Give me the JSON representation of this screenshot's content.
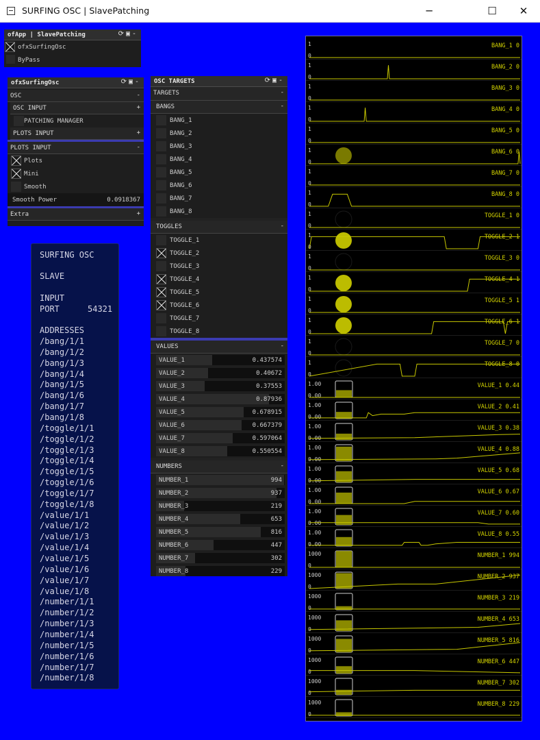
{
  "window": {
    "title": "SURFING OSC | SlavePatching",
    "minimize": "─",
    "maximize": "☐",
    "close": "✕"
  },
  "app_panel": {
    "title": "ofApp | SlavePatching",
    "items": [
      {
        "label": "ofxSurfingOsc",
        "checked": true
      },
      {
        "label": "ByPass",
        "checked": false
      }
    ]
  },
  "surfing_panel": {
    "title": "ofxSurfingOsc",
    "osc_label": "OSC",
    "osc_toggle": "-",
    "osc_input_label": "OSC INPUT",
    "osc_input_toggle": "+",
    "patching_manager": "PATCHING MANAGER",
    "plots_input_label": "PLOTS INPUT",
    "plots_input_toggle": "+",
    "plots_input2_label": "PLOTS INPUT",
    "plots_input2_toggle": "-",
    "plots": "Plots",
    "mini": "Mini",
    "smooth": "Smooth",
    "smooth_power_label": "Smooth Power",
    "smooth_power_value": "0.0918367",
    "extra_label": "Extra",
    "extra_toggle": "+"
  },
  "osc_targets": {
    "title": "OSC TARGETS",
    "targets_label": "TARGETS",
    "targets_toggle": "-",
    "bangs_label": "BANGS",
    "bangs_toggle": "-",
    "bangs": [
      "BANG_1",
      "BANG_2",
      "BANG_3",
      "BANG_4",
      "BANG_5",
      "BANG_6",
      "BANG_7",
      "BANG_8"
    ],
    "toggles_label": "TOGGLES",
    "toggles_toggle": "-",
    "toggles": [
      {
        "label": "TOGGLE_1",
        "on": false
      },
      {
        "label": "TOGGLE_2",
        "on": true
      },
      {
        "label": "TOGGLE_3",
        "on": false
      },
      {
        "label": "TOGGLE_4",
        "on": true
      },
      {
        "label": "TOGGLE_5",
        "on": true
      },
      {
        "label": "TOGGLE_6",
        "on": true
      },
      {
        "label": "TOGGLE_7",
        "on": false
      },
      {
        "label": "TOGGLE_8",
        "on": false
      }
    ],
    "values_label": "VALUES",
    "values_toggle": "-",
    "values": [
      {
        "label": "VALUE_1",
        "value": "0.437574",
        "fraction": 0.437574
      },
      {
        "label": "VALUE_2",
        "value": "0.40672",
        "fraction": 0.40672
      },
      {
        "label": "VALUE_3",
        "value": "0.37553",
        "fraction": 0.37553
      },
      {
        "label": "VALUE_4",
        "value": "0.87936",
        "fraction": 0.87936
      },
      {
        "label": "VALUE_5",
        "value": "0.678915",
        "fraction": 0.678915
      },
      {
        "label": "VALUE_6",
        "value": "0.667379",
        "fraction": 0.667379
      },
      {
        "label": "VALUE_7",
        "value": "0.597064",
        "fraction": 0.597064
      },
      {
        "label": "VALUE_8",
        "value": "0.550554",
        "fraction": 0.550554
      }
    ],
    "numbers_label": "NUMBERS",
    "numbers_toggle": "-",
    "numbers": [
      {
        "label": "NUMBER_1",
        "value": "994",
        "fraction": 0.994
      },
      {
        "label": "NUMBER_2",
        "value": "937",
        "fraction": 0.937
      },
      {
        "label": "NUMBER_3",
        "value": "219",
        "fraction": 0.219
      },
      {
        "label": "NUMBER_4",
        "value": "653",
        "fraction": 0.653
      },
      {
        "label": "NUMBER_5",
        "value": "816",
        "fraction": 0.816
      },
      {
        "label": "NUMBER_6",
        "value": "447",
        "fraction": 0.447
      },
      {
        "label": "NUMBER_7",
        "value": "302",
        "fraction": 0.302
      },
      {
        "label": "NUMBER_8",
        "value": "229",
        "fraction": 0.229
      }
    ]
  },
  "info": {
    "title": "SURFING OSC",
    "mode": "SLAVE",
    "input": "INPUT",
    "port_label": "PORT",
    "port_value": "54321",
    "addresses_label": "ADDRESSES",
    "addresses": [
      "/bang/1/1",
      "/bang/1/2",
      "/bang/1/3",
      "/bang/1/4",
      "/bang/1/5",
      "/bang/1/6",
      "/bang/1/7",
      "/bang/1/8",
      "/toggle/1/1",
      "/toggle/1/2",
      "/toggle/1/3",
      "/toggle/1/4",
      "/toggle/1/5",
      "/toggle/1/6",
      "/toggle/1/7",
      "/toggle/1/8",
      "/value/1/1",
      "/value/1/2",
      "/value/1/3",
      "/value/1/4",
      "/value/1/5",
      "/value/1/6",
      "/value/1/7",
      "/value/1/8",
      "/number/1/1",
      "/number/1/2",
      "/number/1/3",
      "/number/1/4",
      "/number/1/5",
      "/number/1/6",
      "/number/1/7",
      "/number/1/8"
    ]
  },
  "colors": {
    "background": "#0000ff",
    "plot_line": "#c8c800",
    "plot_text": "#d4d400",
    "plot_bg": "#000000",
    "panel": "#1e1e1e"
  },
  "plots": [
    {
      "label": "BANG_1 0",
      "top": "1",
      "bottom": "0",
      "kind": "bang",
      "level": 0,
      "trace": [
        [
          0,
          0
        ],
        [
          1,
          0
        ]
      ]
    },
    {
      "label": "BANG_2 0",
      "top": "1",
      "bottom": "0",
      "kind": "bang",
      "level": 0,
      "trace": [
        [
          0,
          0
        ],
        [
          0.37,
          0
        ],
        [
          0.375,
          0.9
        ],
        [
          0.38,
          0
        ],
        [
          1,
          0
        ]
      ]
    },
    {
      "label": "BANG_3 0",
      "top": "1",
      "bottom": "0",
      "kind": "bang",
      "level": 0,
      "trace": [
        [
          0,
          0
        ],
        [
          1,
          0
        ]
      ]
    },
    {
      "label": "BANG_4 0",
      "top": "1",
      "bottom": "0",
      "kind": "bang",
      "level": 0,
      "trace": [
        [
          0,
          0
        ],
        [
          0.26,
          0
        ],
        [
          0.265,
          0.9
        ],
        [
          0.27,
          0
        ],
        [
          1,
          0
        ]
      ]
    },
    {
      "label": "BANG_5 0",
      "top": "1",
      "bottom": "0",
      "kind": "bang",
      "level": 0,
      "trace": [
        [
          0,
          0
        ],
        [
          1,
          0
        ]
      ]
    },
    {
      "label": "BANG_6 0",
      "top": "1",
      "bottom": "0",
      "kind": "bang",
      "level": 0.6,
      "trace": [
        [
          0,
          0
        ],
        [
          0.99,
          0
        ],
        [
          0.995,
          0.8
        ],
        [
          1,
          0
        ]
      ]
    },
    {
      "label": "BANG_7 0",
      "top": "1",
      "bottom": "0",
      "kind": "bang",
      "level": 0,
      "trace": [
        [
          0,
          0
        ],
        [
          1,
          0
        ]
      ]
    },
    {
      "label": "BANG_8 0",
      "top": "1",
      "bottom": "0",
      "kind": "bang",
      "level": 0,
      "trace": [
        [
          0,
          0
        ],
        [
          0.09,
          0
        ],
        [
          0.11,
          0.8
        ],
        [
          0.18,
          0.8
        ],
        [
          0.2,
          0
        ],
        [
          1,
          0
        ]
      ]
    },
    {
      "label": "TOGGLE_1 0",
      "top": "1",
      "bottom": "0",
      "kind": "toggle",
      "level": 0,
      "trace": [
        [
          0,
          0
        ],
        [
          1,
          0
        ]
      ]
    },
    {
      "label": "TOGGLE_2 1",
      "top": "1",
      "bottom": "0",
      "kind": "toggle",
      "level": 1,
      "trace": [
        [
          0,
          0
        ],
        [
          0.01,
          0.8
        ],
        [
          0.64,
          0.8
        ],
        [
          0.65,
          0
        ],
        [
          0.8,
          0
        ],
        [
          0.81,
          0.8
        ],
        [
          1,
          0.8
        ]
      ]
    },
    {
      "label": "TOGGLE_3 0",
      "top": "1",
      "bottom": "0",
      "kind": "toggle",
      "level": 0,
      "trace": [
        [
          0,
          0
        ],
        [
          1,
          0
        ]
      ]
    },
    {
      "label": "TOGGLE_4 1",
      "top": "1",
      "bottom": "0",
      "kind": "toggle",
      "level": 1,
      "trace": [
        [
          0,
          0
        ],
        [
          0.75,
          0
        ],
        [
          0.76,
          0.8
        ],
        [
          1,
          0.8
        ]
      ]
    },
    {
      "label": "TOGGLE_5 1",
      "top": "1",
      "bottom": "0",
      "kind": "toggle",
      "level": 1,
      "trace": [
        [
          0,
          0
        ],
        [
          1,
          0
        ]
      ]
    },
    {
      "label": "TOGGLE_6 1",
      "top": "1",
      "bottom": "0",
      "kind": "toggle",
      "level": 1,
      "trace": [
        [
          0,
          0
        ],
        [
          0.58,
          0
        ],
        [
          0.59,
          0.8
        ],
        [
          0.92,
          0.8
        ],
        [
          0.93,
          0
        ],
        [
          0.94,
          0.8
        ],
        [
          1,
          0.8
        ]
      ]
    },
    {
      "label": "TOGGLE_7 0",
      "top": "1",
      "bottom": "0",
      "kind": "toggle",
      "level": 0,
      "trace": [
        [
          0,
          0
        ],
        [
          1,
          0
        ]
      ]
    },
    {
      "label": "TOGGLE_8 0",
      "top": "1",
      "bottom": "0",
      "kind": "toggle",
      "level": 0,
      "trace": [
        [
          0,
          0
        ],
        [
          0.32,
          0.8
        ],
        [
          0.43,
          0.8
        ],
        [
          0.44,
          0
        ],
        [
          0.5,
          0
        ],
        [
          0.51,
          0.8
        ],
        [
          1,
          0.8
        ]
      ]
    },
    {
      "label": "VALUE_1 0.44",
      "top": "1.00",
      "bottom": "0.00",
      "kind": "value",
      "level": 0.44,
      "trace": [
        [
          0,
          0
        ],
        [
          1,
          0
        ]
      ]
    },
    {
      "label": "VALUE_2 0.41",
      "top": "1.00",
      "bottom": "0.00",
      "kind": "value",
      "level": 0.41,
      "trace": [
        [
          0,
          0.05
        ],
        [
          0.27,
          0.05
        ],
        [
          0.28,
          0.4
        ],
        [
          0.3,
          0.2
        ],
        [
          0.34,
          0.3
        ],
        [
          0.45,
          0.3
        ],
        [
          0.5,
          0.4
        ],
        [
          1,
          0.4
        ]
      ]
    },
    {
      "label": "VALUE_3 0.38",
      "top": "1.00",
      "bottom": "0.00",
      "kind": "value",
      "level": 0.38,
      "trace": [
        [
          0,
          0.1
        ],
        [
          0.5,
          0.15
        ],
        [
          0.9,
          0.35
        ],
        [
          1,
          0.38
        ]
      ]
    },
    {
      "label": "VALUE_4 0.88",
      "top": "1.00",
      "bottom": "0.00",
      "kind": "value",
      "level": 0.88,
      "trace": [
        [
          0,
          0.1
        ],
        [
          0.6,
          0.15
        ],
        [
          0.7,
          0.2
        ],
        [
          1,
          0.55
        ]
      ]
    },
    {
      "label": "VALUE_5 0.68",
      "top": "1.00",
      "bottom": "0.00",
      "kind": "value",
      "level": 0.68,
      "trace": [
        [
          0,
          0.1
        ],
        [
          0.5,
          0.2
        ],
        [
          1,
          0.2
        ]
      ]
    },
    {
      "label": "VALUE_6 0.67",
      "top": "1.00",
      "bottom": "0.00",
      "kind": "value",
      "level": 0.67,
      "trace": [
        [
          0,
          0
        ],
        [
          0.45,
          0
        ],
        [
          0.5,
          0.15
        ],
        [
          1,
          0.15
        ]
      ]
    },
    {
      "label": "VALUE_7 0.60",
      "top": "1.00",
      "bottom": "0.00",
      "kind": "value",
      "level": 0.6,
      "trace": [
        [
          0,
          0.15
        ],
        [
          0.8,
          0.15
        ],
        [
          0.85,
          0.05
        ],
        [
          1,
          0.05
        ]
      ]
    },
    {
      "label": "VALUE_8 0.55",
      "top": "1.00",
      "bottom": "0.00",
      "kind": "value",
      "level": 0.55,
      "trace": [
        [
          0,
          0.05
        ],
        [
          0.44,
          0.05
        ],
        [
          0.45,
          0.25
        ],
        [
          0.52,
          0.25
        ],
        [
          0.53,
          0.05
        ],
        [
          0.56,
          0.05
        ],
        [
          0.6,
          0.15
        ],
        [
          0.7,
          0.25
        ],
        [
          1,
          0.25
        ]
      ]
    },
    {
      "label": "NUMBER_1 994",
      "top": "1000",
      "bottom": "0",
      "kind": "number",
      "level": 0.994,
      "trace": [
        [
          0,
          0
        ],
        [
          1,
          0
        ]
      ]
    },
    {
      "label": "NUMBER_2 937",
      "top": "1000",
      "bottom": "0",
      "kind": "number",
      "level": 0.937,
      "trace": [
        [
          0,
          0
        ],
        [
          0.42,
          0.3
        ],
        [
          0.6,
          0.3
        ],
        [
          1,
          0.9
        ]
      ]
    },
    {
      "label": "NUMBER_3 219",
      "top": "1000",
      "bottom": "0",
      "kind": "number",
      "level": 0.219,
      "trace": [
        [
          0,
          0.05
        ],
        [
          1,
          0.05
        ]
      ]
    },
    {
      "label": "NUMBER_4 653",
      "top": "1000",
      "bottom": "0",
      "kind": "number",
      "level": 0.653,
      "trace": [
        [
          0,
          0.1
        ],
        [
          0.8,
          0.25
        ],
        [
          1,
          0.5
        ]
      ]
    },
    {
      "label": "NUMBER_5 816",
      "top": "1000",
      "bottom": "0",
      "kind": "number",
      "level": 0.816,
      "trace": [
        [
          0,
          0.1
        ],
        [
          0.7,
          0.2
        ],
        [
          1,
          0.65
        ]
      ]
    },
    {
      "label": "NUMBER_6 447",
      "top": "1000",
      "bottom": "0",
      "kind": "number",
      "level": 0.447,
      "trace": [
        [
          0,
          0.2
        ],
        [
          0.5,
          0.2
        ],
        [
          1,
          0.05
        ]
      ]
    },
    {
      "label": "NUMBER_7 302",
      "top": "1000",
      "bottom": "0",
      "kind": "number",
      "level": 0.302,
      "trace": [
        [
          0,
          0.2
        ],
        [
          0.5,
          0.3
        ],
        [
          1,
          0.3
        ]
      ]
    },
    {
      "label": "NUMBER_8 229",
      "top": "1000",
      "bottom": "0",
      "kind": "number",
      "level": 0.229,
      "trace": [
        [
          0,
          0.05
        ],
        [
          1,
          0.05
        ]
      ]
    }
  ]
}
